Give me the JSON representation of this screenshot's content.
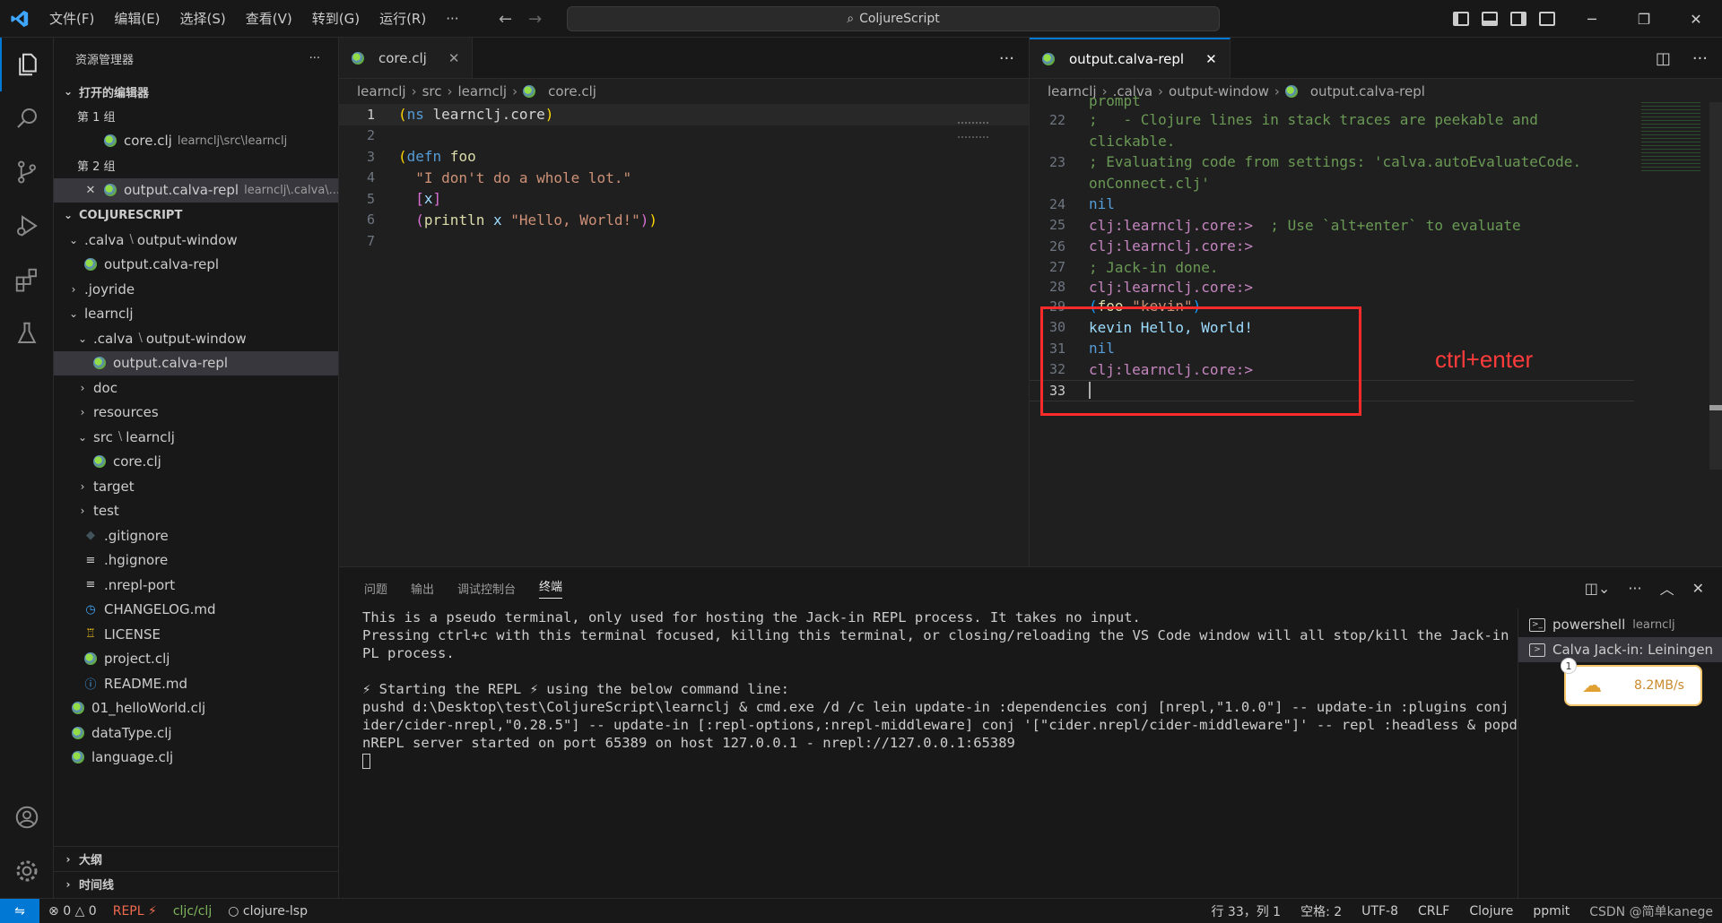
{
  "titlebar": {
    "menu": [
      "文件(F)",
      "编辑(E)",
      "选择(S)",
      "查看(V)",
      "转到(G)",
      "运行(R)",
      "···"
    ],
    "search_text": "ColjureScript"
  },
  "sidebar": {
    "title": "资源管理器",
    "open_editors_label": "打开的编辑器",
    "group1_label": "第 1 组",
    "group1_file": "core.clj",
    "group1_file_path": "learnclj\\src\\learnclj",
    "group2_label": "第 2 组",
    "group2_file": "output.calva-repl",
    "group2_file_path": "learnclj\\.calva\\...",
    "project_label": "COLJURESCRIPT",
    "tree": [
      {
        "label": ".calva",
        "suffix": "output-window"
      },
      {
        "label": "output.calva-repl"
      },
      {
        "label": ".joyride"
      },
      {
        "label": "learnclj"
      },
      {
        "label": ".calva",
        "suffix": "output-window"
      },
      {
        "label": "output.calva-repl"
      },
      {
        "label": "doc"
      },
      {
        "label": "resources"
      },
      {
        "label": "src",
        "suffix": "learnclj"
      },
      {
        "label": "core.clj"
      },
      {
        "label": "target"
      },
      {
        "label": "test"
      },
      {
        "label": ".gitignore"
      },
      {
        "label": ".hgignore"
      },
      {
        "label": ".nrepl-port"
      },
      {
        "label": "CHANGELOG.md"
      },
      {
        "label": "LICENSE"
      },
      {
        "label": "project.clj"
      },
      {
        "label": "README.md"
      },
      {
        "label": "01_helloWorld.clj"
      },
      {
        "label": "dataType.clj"
      },
      {
        "label": "language.clj"
      }
    ],
    "outline_label": "大纲",
    "timeline_label": "时间线"
  },
  "editor1": {
    "tab": "core.clj",
    "breadcrumb": [
      "learnclj",
      "src",
      "learnclj",
      "core.clj"
    ],
    "line_numbers": [
      "1",
      "2",
      "3",
      "4",
      "5",
      "6",
      "7"
    ]
  },
  "editor2": {
    "tab": "output.calva-repl",
    "breadcrumb": [
      "learnclj",
      ".calva",
      "output-window",
      "output.calva-repl"
    ],
    "line_numbers": [
      "",
      "22",
      "",
      "23",
      "",
      "24",
      "25",
      "26",
      "27",
      "28",
      "29",
      "30",
      "31",
      "32",
      "33"
    ],
    "annotation": "ctrl+enter"
  },
  "panel": {
    "tabs": [
      "问题",
      "输出",
      "调试控制台",
      "终端"
    ],
    "terminal_lines": [
      "This is a pseudo terminal, only used for hosting the Jack-in REPL process. It takes no input.",
      "Pressing ctrl+c with this terminal focused, killing this terminal, or closing/reloading the VS Code window will all stop/kill the Jack-in RE",
      "PL process.",
      "",
      "⚡ Starting the REPL ⚡ using the below command line:",
      "pushd d:\\Desktop\\test\\ColjureScript\\learnclj & cmd.exe /d /c lein update-in :dependencies conj [nrepl,\"1.0.0\"] -- update-in :plugins conj [c",
      "ider/cider-nrepl,\"0.28.5\"] -- update-in [:repl-options,:nrepl-middleware] conj '[\"cider.nrepl/cider-middleware\"]' -- repl :headless & popd",
      "nREPL server started on port 65389 on host 127.0.0.1 - nrepl://127.0.0.1:65389"
    ],
    "terminals": [
      {
        "name": "powershell",
        "sub": "learnclj"
      },
      {
        "name": "Calva Jack-in: Leiningen",
        "sub": ""
      }
    ],
    "speed_badge": "1",
    "speed": "8.2MB/s"
  },
  "statusbar": {
    "errors": "0",
    "warnings": "0",
    "repl": "REPL",
    "repl_glyph": "⚡",
    "dialect": "cljc/clj",
    "lsp": "clojure-lsp",
    "position": "行 33，列 1",
    "spaces": "空格: 2",
    "encoding": "UTF-8",
    "eol": "CRLF",
    "language": "Clojure",
    "extra": "ppmit",
    "watermark": "CSDN @简单kanege"
  },
  "colors": {
    "accent": "#0078d4",
    "annotation_red": "#ff2a2a"
  }
}
